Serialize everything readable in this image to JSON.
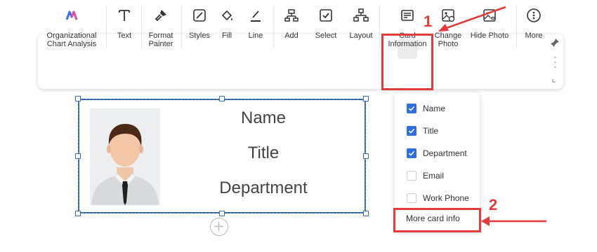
{
  "toolbar": {
    "items": [
      {
        "label": "Organizational\nChart Analysis",
        "icon": "org-chart-analysis-icon"
      },
      {
        "label": "Text",
        "icon": "text-icon"
      },
      {
        "label": "Format\nPainter",
        "icon": "format-painter-icon"
      },
      {
        "label": "Styles",
        "icon": "styles-icon"
      },
      {
        "label": "Fill",
        "icon": "fill-icon"
      },
      {
        "label": "Line",
        "icon": "line-icon"
      },
      {
        "label": "Add",
        "icon": "add-icon"
      },
      {
        "label": "Select",
        "icon": "select-icon"
      },
      {
        "label": "Layout",
        "icon": "layout-icon"
      },
      {
        "label": "Card\nInformation",
        "icon": "card-information-icon"
      },
      {
        "label": "Change\nPhoto",
        "icon": "change-photo-icon"
      },
      {
        "label": "Hide Photo",
        "icon": "hide-photo-icon"
      },
      {
        "label": "More",
        "icon": "more-icon"
      }
    ]
  },
  "callouts": {
    "one": "1",
    "two": "2"
  },
  "card": {
    "name": "Name",
    "title": "Title",
    "department": "Department"
  },
  "menu": {
    "items": [
      {
        "label": "Name",
        "checked": true
      },
      {
        "label": "Title",
        "checked": true
      },
      {
        "label": "Department",
        "checked": true
      },
      {
        "label": "Email",
        "checked": false
      },
      {
        "label": "Work Phone",
        "checked": false
      }
    ],
    "more": "More card info"
  },
  "colors": {
    "accent": "#2f6fe0",
    "callout": "#e23b3b",
    "card_border": "#2b5ea8"
  }
}
